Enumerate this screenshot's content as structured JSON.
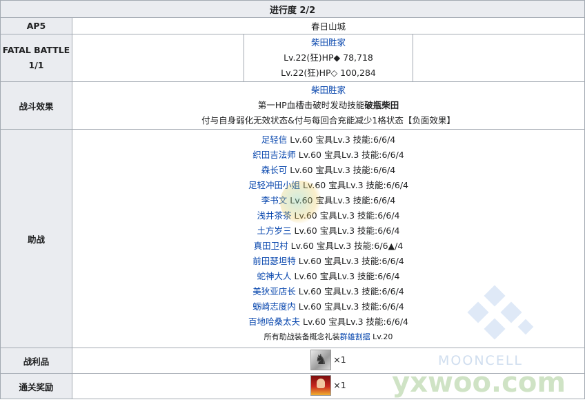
{
  "title": "进行度 2/2",
  "ap": {
    "label": "AP5",
    "location": "春日山城"
  },
  "battle": {
    "label_line1": "FATAL BATTLE",
    "label_line2": "1/1",
    "enemy_name": "柴田胜家",
    "enemy_line1": "Lv.22(狂)HP◆ 78,718",
    "enemy_line2": "Lv.22(狂)HP◇ 100,284"
  },
  "effect": {
    "label": "战斗效果",
    "name": "柴田胜家",
    "line1_prefix": "第一HP血槽击破时发动技能",
    "line1_bold": "破瓶柴田",
    "line2": "付与自身弱化无效状态&付与每回合充能减少1格状态【负面效果】"
  },
  "support": {
    "label": "助战",
    "members": [
      {
        "name": "足轻信",
        "stats": " Lv.60 宝具Lv.3 技能:6/6/4"
      },
      {
        "name": "织田吉法师",
        "stats": " Lv.60 宝具Lv.3 技能:6/6/4"
      },
      {
        "name": "森长可",
        "stats": " Lv.60 宝具Lv.3 技能:6/6/4"
      },
      {
        "name": "足轻冲田小姐",
        "stats": " Lv.60 宝具Lv.3 技能:6/6/4"
      },
      {
        "name": "李书文",
        "stats": " Lv.60 宝具Lv.3 技能:6/6/4"
      },
      {
        "name": "浅井茶茶",
        "stats": " Lv.60 宝具Lv.3 技能:6/6/4"
      },
      {
        "name": "土方岁三",
        "stats": " Lv.60 宝具Lv.3 技能:6/6/4"
      },
      {
        "name": "真田卫村",
        "stats": " Lv.60 宝具Lv.3 技能:6/6▲/4"
      },
      {
        "name": "前田瑟坦特",
        "stats": " Lv.60 宝具Lv.3 技能:6/6/4"
      },
      {
        "name": "蛇神大人",
        "stats": " Lv.60 宝具Lv.3 技能:6/6/4"
      },
      {
        "name": "美狄亚店长",
        "stats": " Lv.60 宝具Lv.3 技能:6/6/4"
      },
      {
        "name": "蛎崎志度内",
        "stats": " Lv.60 宝具Lv.3 技能:6/6/4"
      },
      {
        "name": "百地哈桑太夫",
        "stats": " Lv.60 宝具Lv.3 技能:6/6/4"
      }
    ],
    "note_prefix": "所有助战装备概念礼装",
    "note_link": "群雄割据",
    "note_suffix": " Lv.20"
  },
  "drops": {
    "label": "战利品",
    "count": "×1",
    "icon": "knight-coin-icon"
  },
  "reward": {
    "label": "通关奖励",
    "count": "×1",
    "icon": "craft-essence-icon"
  },
  "watermark": {
    "text": "MOONCELL",
    "site": "yxwoo.com"
  },
  "colors": {
    "header_bg": "#eaecf0",
    "border": "#a2a9b1",
    "link": "#0645ad"
  }
}
